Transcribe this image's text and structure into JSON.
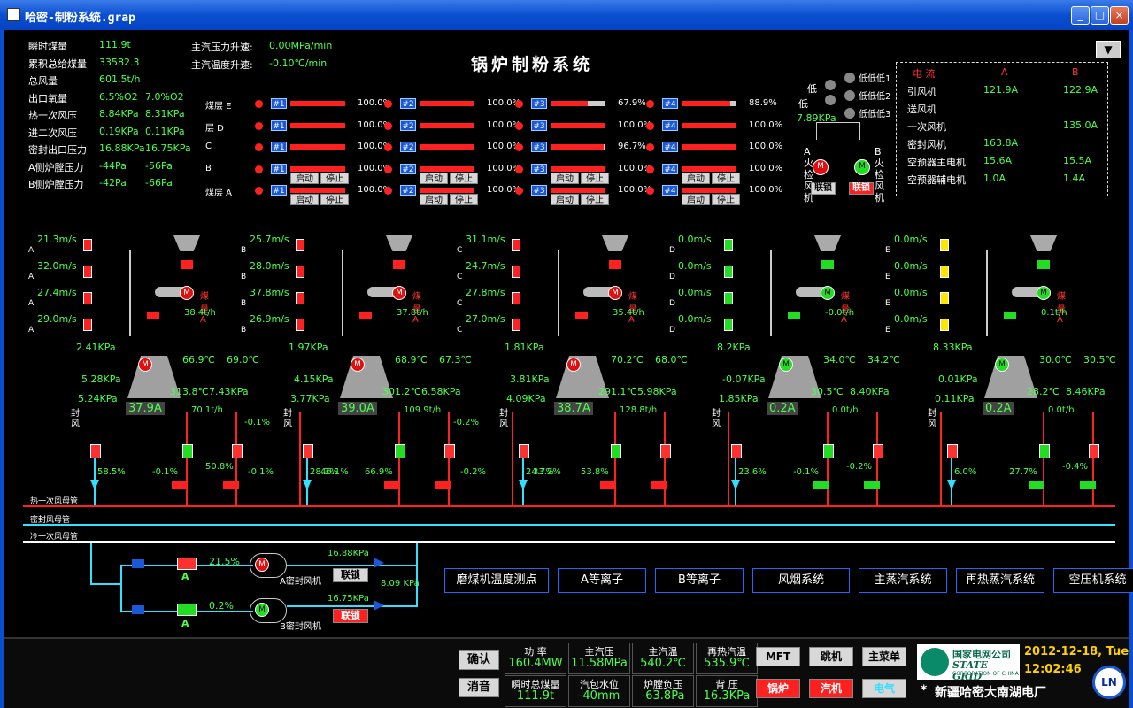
{
  "window": {
    "title": "哈密-制粉系统.grap"
  },
  "header": {
    "title": "锅炉制粉系统"
  },
  "top_left": [
    {
      "label": "瞬时煤量",
      "v1": "111.9t",
      "v2": ""
    },
    {
      "label": "累积总给煤量",
      "v1": "33582.3",
      "v2": ""
    },
    {
      "label": "总风量",
      "v1": "601.5t/h",
      "v2": ""
    },
    {
      "label": "出口氧量",
      "v1": "6.5%O2",
      "v2": "7.0%O2"
    },
    {
      "label": "热一次风压",
      "v1": "8.84KPa",
      "v2": "8.31KPa"
    },
    {
      "label": "进二次风压",
      "v1": "0.19KPa",
      "v2": "0.11KPa"
    },
    {
      "label": "密封出口压力",
      "v1": "16.88KPa",
      "v2": "16.75KPa"
    },
    {
      "label": "A侧炉膛压力",
      "v1": "-44Pa",
      "v2": "-56Pa"
    },
    {
      "label": "B侧炉膛压力",
      "v1": "-42Pa",
      "v2": "-66Pa"
    }
  ],
  "rates": {
    "pressure_label": "主汽压力升速:",
    "pressure_value": "0.00MPa/min",
    "temp_label": "主汽温度升速:",
    "temp_value": "-0.10℃/min"
  },
  "layers": [
    {
      "label": "煤层 E",
      "pcts": [
        "100.0%",
        "100.0%",
        "67.9%",
        "88.9%"
      ]
    },
    {
      "label": "层 D",
      "pcts": [
        "100.0%",
        "100.0%",
        "100.0%",
        "100.0%"
      ]
    },
    {
      "label": "C",
      "pcts": [
        "100.0%",
        "100.0%",
        "96.7%",
        "100.0%"
      ]
    },
    {
      "label": "B",
      "pcts": [
        "100.0%",
        "100.0%",
        "100.0%",
        "100.0%"
      ]
    },
    {
      "label": "煤层 A",
      "pcts": [
        "100.0%",
        "100.0%",
        "100.0%",
        "100.0%"
      ]
    }
  ],
  "burner_tags": [
    "#1",
    "#2",
    "#3",
    "#4"
  ],
  "btn_start": "启动",
  "btn_stop": "停止",
  "flame": {
    "low": "低",
    "low2": "低",
    "pressure": "7.89KPa",
    "lowlow": [
      "低低低1",
      "低低低2",
      "低低低3"
    ],
    "a_label": "A火检风机",
    "b_label": "B火检风机",
    "lock_a": "联锁",
    "lock_b": "联锁"
  },
  "current_panel": {
    "header": [
      "电  流",
      "A",
      "B"
    ],
    "rows": [
      {
        "name": "引风机",
        "a": "121.9A",
        "b": "122.9A"
      },
      {
        "name": "送风机",
        "a": "",
        "b": ""
      },
      {
        "name": "一次风机",
        "a": "",
        "b": "135.0A"
      },
      {
        "name": "密封风机",
        "a": "163.8A",
        "b": ""
      },
      {
        "name": "空预器主电机",
        "a": "15.6A",
        "b": "15.5A"
      },
      {
        "name": "空预器辅电机",
        "a": "1.0A",
        "b": "1.4A"
      }
    ]
  },
  "mills": [
    {
      "letter": "A",
      "v": [
        "21.3m/s",
        "32.0m/s",
        "27.4m/s",
        "29.0m/s"
      ],
      "coal": "煤量 A",
      "flow": "38.4t/h",
      "p1": "2.41KPa",
      "p2": "5.28KPa",
      "p3": "5.24KPa",
      "t1": "66.9℃",
      "t2": "69.0℃",
      "t3": "313.8℃",
      "p4": "7.43KPa",
      "cur": "37.9A",
      "feed": "70.1t/h",
      "valve_a": "58.5%",
      "valve_b": "-0.1%",
      "valve_c": "50.8%",
      "valve_d": "-0.1%",
      "seal": "封风",
      "seal_valve": "46.1%"
    },
    {
      "letter": "B",
      "v": [
        "25.7m/s",
        "28.0m/s",
        "37.8m/s",
        "26.9m/s"
      ],
      "coal": "煤量 A",
      "flow": "37.8t/h",
      "p1": "1.97KPa",
      "p2": "4.15KPa",
      "p3": "3.77KPa",
      "t1": "68.9℃",
      "t2": "67.3℃",
      "t3": "301.2℃",
      "p4": "6.58KPa",
      "cur": "39.0A",
      "feed": "109.9t/h",
      "valve_a": "28.3%",
      "valve_b": "66.9%",
      "valve_c": "",
      "valve_d": "-0.2%",
      "seal": "封风",
      "seal_valve": "33.2%"
    },
    {
      "letter": "C",
      "v": [
        "31.1m/s",
        "24.7m/s",
        "27.8m/s",
        "27.0m/s"
      ],
      "coal": "煤量 A",
      "flow": "35.4t/h",
      "p1": "1.81KPa",
      "p2": "3.81KPa",
      "p3": "4.09KPa",
      "t1": "70.2℃",
      "t2": "68.0℃",
      "t3": "291.1℃",
      "p4": "5.98KPa",
      "cur": "38.7A",
      "feed": "128.8t/h",
      "valve_a": "24.7%",
      "valve_b": "53.8%",
      "valve_c": "",
      "valve_d": "",
      "seal": "封风",
      "seal_valve": ""
    },
    {
      "letter": "D",
      "v": [
        "0.0m/s",
        "0.0m/s",
        "0.0m/s",
        "0.0m/s"
      ],
      "coal": "煤量 A",
      "flow": "-0.0t/h",
      "p1": "8.2KPa",
      "p2": "-0.07KPa",
      "p3": "1.85KPa",
      "t1": "34.0℃",
      "t2": "34.2℃",
      "t3": "30.5℃",
      "p4": "8.40KPa",
      "cur": "0.2A",
      "feed": "0.0t/h",
      "valve_a": "23.6%",
      "valve_b": "-0.1%",
      "valve_c": "-0.2%",
      "valve_d": "",
      "seal": "封风",
      "seal_valve": ""
    },
    {
      "letter": "E",
      "v": [
        "0.0m/s",
        "0.0m/s",
        "0.0m/s",
        "0.0m/s"
      ],
      "coal": "煤量 A",
      "flow": "0.1t/h",
      "p1": "8.33KPa",
      "p2": "0.01KPa",
      "p3": "0.11KPa",
      "t1": "30.0℃",
      "t2": "30.5℃",
      "t3": "28.2℃",
      "p4": "8.46KPa",
      "cur": "0.2A",
      "feed": "0.0t/h",
      "valve_a": "6.0%",
      "valve_b": "27.7%",
      "valve_c": "-0.4%",
      "valve_d": "",
      "seal": "封风",
      "seal_valve": ""
    }
  ],
  "mill_a_extra": {
    "neg": "-0.1%",
    "neg2": "-0.2%"
  },
  "headers": {
    "hot_primary": "热一次风母管",
    "seal_air": "密封风母管",
    "cold_primary": "冷一次风母管"
  },
  "seal_fans": {
    "a_pct": "21.5%",
    "a_label": "A密封风机",
    "a_press": "16.88KPa",
    "diff": "8.09  KPa",
    "b_pct": "0.2%",
    "b_label": "B密封风机",
    "b_press": "16.75KPa",
    "lock": "联锁",
    "lock2": "联锁",
    "a_tag": "A",
    "b_tag": "A"
  },
  "nav": [
    "磨煤机温度测点",
    "A等离子",
    "B等离子",
    "风烟系统",
    "主蒸汽系统",
    "再热蒸汽系统",
    "空压机系统"
  ],
  "footer": {
    "confirm": "确认",
    "mute": "消音",
    "stats": [
      {
        "label": "功 率",
        "value": "160.4MW"
      },
      {
        "label": "主汽压",
        "value": "11.58MPa"
      },
      {
        "label": "主汽温",
        "value": "540.2℃"
      },
      {
        "label": "再热汽温",
        "value": "535.9℃"
      },
      {
        "label": "瞬时总煤量",
        "value": "111.9t"
      },
      {
        "label": "汽包水位",
        "value": "-40mm"
      },
      {
        "label": "炉膛负压",
        "value": "-63.8Pa"
      },
      {
        "label": "背 压",
        "value": "16.3KPa"
      }
    ],
    "btn_mft": "MFT",
    "btn_trip": "跳机",
    "btn_menu": "主菜单",
    "btn_boiler": "锅炉",
    "btn_turbine": "汽机",
    "btn_elec": "电气",
    "logo_cn": "国家电网公司",
    "logo_en": "STATE GRID",
    "logo_sub": "CORPORATION OF CHINA",
    "date": "2012-12-18, Tue",
    "time": "12:02:46",
    "plant": "新疆哈密大南湖电厂",
    "ln": "LN"
  }
}
